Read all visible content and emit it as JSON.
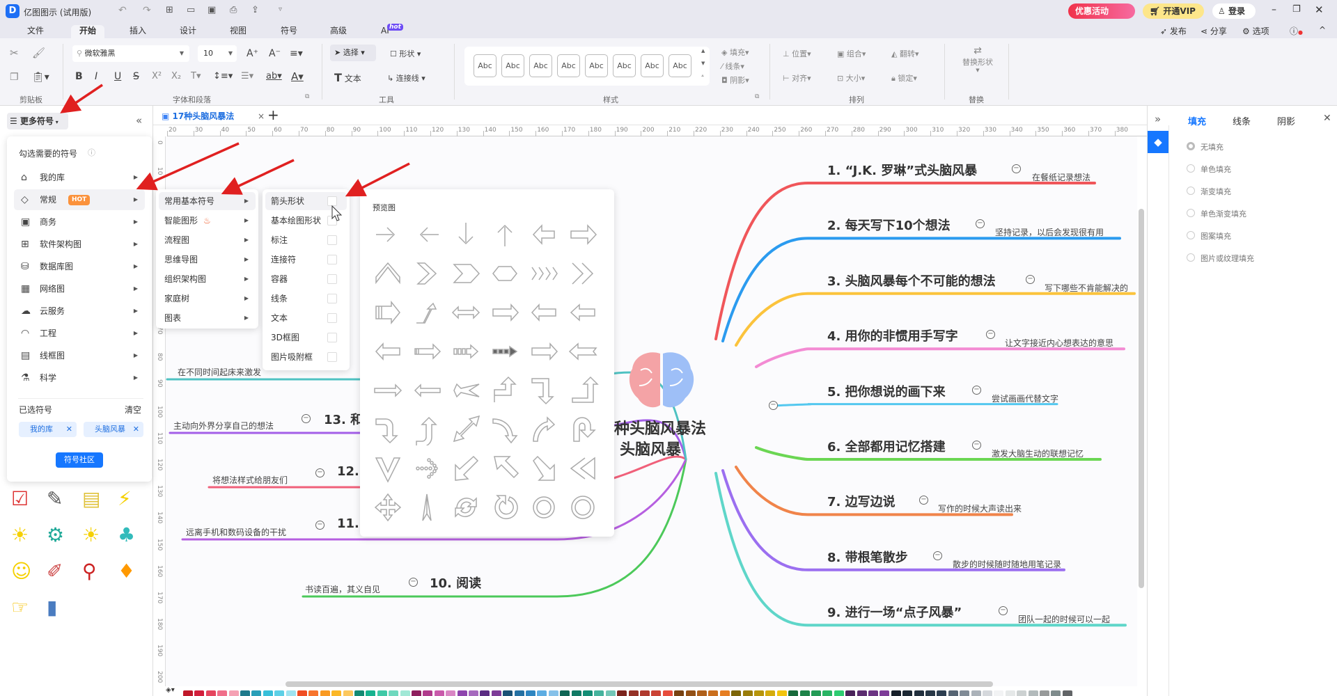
{
  "app": {
    "title": "亿图图示 (试用版)",
    "promo": "优惠活动",
    "vip": "开通VIP",
    "login": "登录"
  },
  "menu_tabs": [
    "文件",
    "开始",
    "插入",
    "设计",
    "视图",
    "符号",
    "高级",
    "AI"
  ],
  "ai_badge": "hot",
  "top_actions": {
    "publish": "发布",
    "share": "分享",
    "options": "选项"
  },
  "ribbon": {
    "font_name": "微软雅黑",
    "font_size": "10",
    "select": "选择",
    "shape": "形状",
    "text": "文本",
    "connector": "连接线",
    "style_sample": "Abc",
    "fill": "填充",
    "line": "线条",
    "shadow": "阴影",
    "position": "位置",
    "group": "组合",
    "flip": "翻转",
    "align": "对齐",
    "size": "大小",
    "lock": "锁定",
    "replace_shape": "替换形状",
    "groups": {
      "clipboard": "剪贴板",
      "font": "字体和段落",
      "tools": "工具",
      "style": "样式",
      "arrange": "排列",
      "replace": "替换"
    }
  },
  "left_panel": {
    "header": "更多符号",
    "prompt": "勾选需要的符号",
    "categories": [
      {
        "label": "我的库",
        "icon": "library-icon"
      },
      {
        "label": "常规",
        "icon": "tag-icon",
        "badge": "HOT"
      },
      {
        "label": "商务",
        "icon": "presentation-icon"
      },
      {
        "label": "软件架构图",
        "icon": "architecture-icon"
      },
      {
        "label": "数据库图",
        "icon": "database-icon"
      },
      {
        "label": "网络图",
        "icon": "network-icon"
      },
      {
        "label": "云服务",
        "icon": "cloud-icon"
      },
      {
        "label": "工程",
        "icon": "helmet-icon"
      },
      {
        "label": "线框图",
        "icon": "wireframe-icon"
      },
      {
        "label": "科学",
        "icon": "flask-icon"
      }
    ],
    "selected_title": "已选符号",
    "clear": "清空",
    "chips": [
      "我的库",
      "头脑风暴"
    ],
    "community": "符号社区"
  },
  "submenu": [
    "常用基本符号",
    "智能图形",
    "流程图",
    "思维导图",
    "组织架构图",
    "家庭树",
    "图表"
  ],
  "submenu2": [
    "箭头形状",
    "基本绘图形状",
    "标注",
    "连接符",
    "容器",
    "线条",
    "文本",
    "3D框图",
    "图片吸附框"
  ],
  "preview": {
    "title": "预览图"
  },
  "doc_tab": "17种头脑风暴法",
  "ruler_top": [
    "20",
    "30",
    "40",
    "50",
    "60",
    "70",
    "80",
    "90",
    "100",
    "110",
    "120",
    "130",
    "140",
    "150",
    "160",
    "170",
    "180",
    "190",
    "200",
    "210",
    "220",
    "230",
    "240",
    "250",
    "260",
    "270",
    "280",
    "290",
    "300",
    "310",
    "320",
    "330",
    "340",
    "350",
    "360",
    "370",
    "380"
  ],
  "ruler_left": [
    "0",
    "10",
    "20",
    "30",
    "40",
    "50",
    "60",
    "70",
    "80",
    "90",
    "100",
    "110",
    "120",
    "130",
    "140",
    "150",
    "160",
    "170",
    "180",
    "190",
    "200"
  ],
  "mindmap": {
    "center": [
      "种头脑风暴法",
      "头脑风暴"
    ],
    "right": [
      {
        "title": "1. “J.K. 罗琳”式头脑风暴",
        "sub": "在餐纸记录想法",
        "color": "#f0565a"
      },
      {
        "title": "2. 每天写下10个想法",
        "sub": "坚持记录，以后会发现很有用",
        "color": "#2b9bef"
      },
      {
        "title": "3. 头脑风暴每个不可能的想法",
        "sub": "写下哪些不肯能解决的",
        "color": "#fbc33c"
      },
      {
        "title": "4. 用你的非惯用手写字",
        "sub": "让文字接近内心想表达的意思",
        "color": "#f38bd3"
      },
      {
        "title": "5. 把你想说的画下来",
        "sub": "尝试画画代替文字",
        "color": "#54c8ef"
      },
      {
        "title": "6. 全部都用记忆搭建",
        "sub": "激发大脑生动的联想记忆",
        "color": "#6bd653"
      },
      {
        "title": "7. 边写边说",
        "sub": "写作的时候大声读出来",
        "color": "#f0844a"
      },
      {
        "title": "8. 带根笔散步",
        "sub": "散步的时候随时随地用笔记录",
        "color": "#9b6ff0"
      },
      {
        "title": "9. 进行一场“点子风暴”",
        "sub": "团队一起的时候可以一起",
        "color": "#5fd6c9"
      }
    ],
    "left": [
      {
        "title": "10. 阅读",
        "sub": "书读百遍，其义自见",
        "color": "#4cc95a"
      },
      {
        "title": "11.",
        "sub": "远离手机和数码设备的干扰",
        "color": "#b65fe0"
      },
      {
        "title": "12.",
        "sub": "将想法样式给朋友们",
        "color": "#f0607a"
      },
      {
        "title": "13. 和",
        "sub": "主动向外界分享自己的想法",
        "color": "#a35ee8"
      },
      {
        "title": "",
        "sub": "在不同时间起床来激发",
        "color": "#4fc2c2"
      }
    ]
  },
  "right_panel": {
    "tabs": [
      "填充",
      "线条",
      "阴影"
    ],
    "options": [
      "无填充",
      "单色填充",
      "渐变填充",
      "单色渐变填充",
      "图案填充",
      "图片或纹理填充"
    ],
    "selected": "无填充",
    "accent": "#1677ff"
  },
  "palette": [
    "#c0182a",
    "#d21f3c",
    "#e5455e",
    "#f06f8a",
    "#f5a1b3",
    "#1f7a8c",
    "#2a9fb8",
    "#38bfd9",
    "#5dd0e6",
    "#9fe3f0",
    "#f04e23",
    "#f7742d",
    "#f99a22",
    "#fbb726",
    "#fcc85e",
    "#138a72",
    "#17b38f",
    "#3fc9a6",
    "#6fd9be",
    "#a1e8d6",
    "#8e1f5e",
    "#b03b8c",
    "#c95aab",
    "#d986c4",
    "#8e44ad",
    "#a569bd",
    "#5b2c83",
    "#7d3c98",
    "#1a5276",
    "#2471a3",
    "#2e86c1",
    "#5dade2",
    "#85c1e9",
    "#0e6655",
    "#117a65",
    "#138d75",
    "#45b39d",
    "#73c6b6",
    "#7b241c",
    "#943126",
    "#b03a2e",
    "#cb4335",
    "#e74c3c",
    "#784212",
    "#935116",
    "#af601a",
    "#ca6f1e",
    "#e67e22",
    "#7d6608",
    "#9a7d0a",
    "#b7950b",
    "#d4ac0d",
    "#f1c40f",
    "#186a3b",
    "#1d8348",
    "#239b56",
    "#28b463",
    "#2ecc71",
    "#4a235a",
    "#5b2c6f",
    "#6c3483",
    "#7d3c98",
    "#17202a",
    "#1c2833",
    "#212f3d",
    "#273746",
    "#2c3e50",
    "#566573",
    "#808b96",
    "#abb2b9",
    "#d5d8dc",
    "#f2f3f4",
    "#e5e8e8",
    "#ccd1d1",
    "#b2babb",
    "#979a9a",
    "#7f8c8d",
    "#626567"
  ],
  "annotation_color": "#e02020"
}
